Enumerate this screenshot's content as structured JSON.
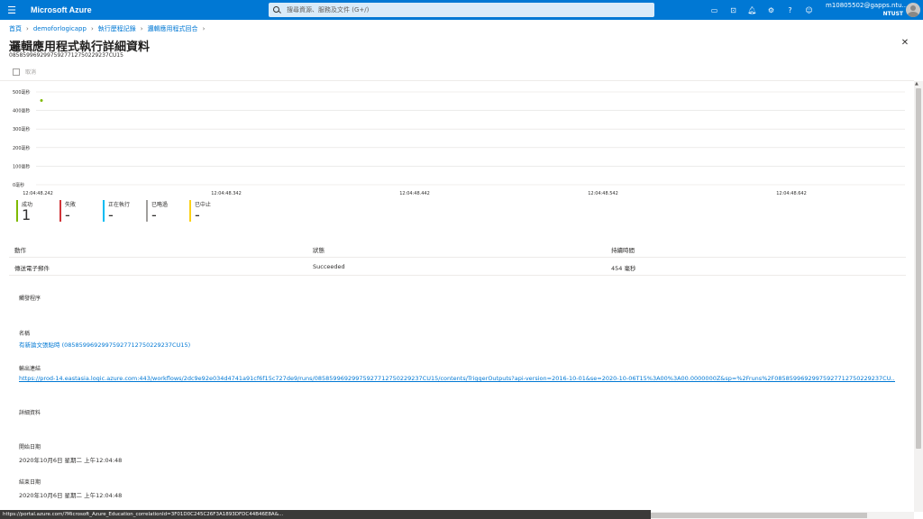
{
  "topbar": {
    "brand": "Microsoft Azure",
    "search_placeholder": "搜尋資源、服務及文件 (G+/)",
    "user_email": "m10805502@gapps.ntu...",
    "user_tenant": "NTUST"
  },
  "breadcrumb": [
    "首頁",
    "demoforlogicapp",
    "執行歷程記錄",
    "邏輯應用程式回合"
  ],
  "page": {
    "title": "邏輯應用程式執行詳細資料",
    "run_id": "08585996929975927712750229237CU15",
    "cancel_label": "取消"
  },
  "chart_data": {
    "type": "scatter",
    "x": [
      "12:04:48.242"
    ],
    "y": [
      454
    ],
    "y_tick_labels": [
      "500毫秒",
      "400毫秒",
      "300毫秒",
      "200毫秒",
      "100毫秒",
      "0毫秒"
    ],
    "y_ticks": [
      500,
      400,
      300,
      200,
      100,
      0
    ],
    "ylim": [
      0,
      500
    ],
    "x_tick_labels": [
      "12:04:48.242",
      "12:04:48.342",
      "12:04:48.442",
      "12:04:48.542",
      "12:04:48.642"
    ],
    "point_color": "#7fba00",
    "grid": true
  },
  "summary": [
    {
      "label": "成功",
      "value": "1",
      "color": "#7fba00"
    },
    {
      "label": "失敗",
      "value": "-",
      "color": "#d13438"
    },
    {
      "label": "正在執行",
      "value": "-",
      "color": "#00bcf2"
    },
    {
      "label": "已略過",
      "value": "-",
      "color": "#a19f9d"
    },
    {
      "label": "已中止",
      "value": "-",
      "color": "#fcd116"
    }
  ],
  "table": {
    "headers": [
      "動作",
      "狀態",
      "持續時間"
    ],
    "rows": [
      [
        "傳送電子郵件",
        "Succeeded",
        "454 毫秒"
      ]
    ]
  },
  "details": {
    "trigger_heading": "觸發程序",
    "name_label": "名稱",
    "name_value": "有新論文張貼時 (08585996929975927712750229237CU15)",
    "output_label": "輸出連結",
    "output_value": "https://prod-14.eastasia.logic.azure.com:443/workflows/2dc9e92e034d4741a91cf6f15c727de9/runs/08585996929975927712750229237CU15/contents/TriggerOutputs?api-version=2016-10-01&se=2020-10-06T15%3A00%3A00.0000000Z&sp=%2Fruns%2F08585996929975927712750229237CU...",
    "detail_heading": "詳細資料",
    "start_label": "開始日期",
    "start_value": "2020年10月6日 星期二 上午12:04:48",
    "end_label": "結束日期",
    "end_value": "2020年10月6日 星期二 上午12:04:48"
  },
  "statusbar": "https://portal.azure.com/?Microsoft_Azure_Education_correlationId=3F01D0C245C26F3A1893DFDC44B46E8A&..."
}
